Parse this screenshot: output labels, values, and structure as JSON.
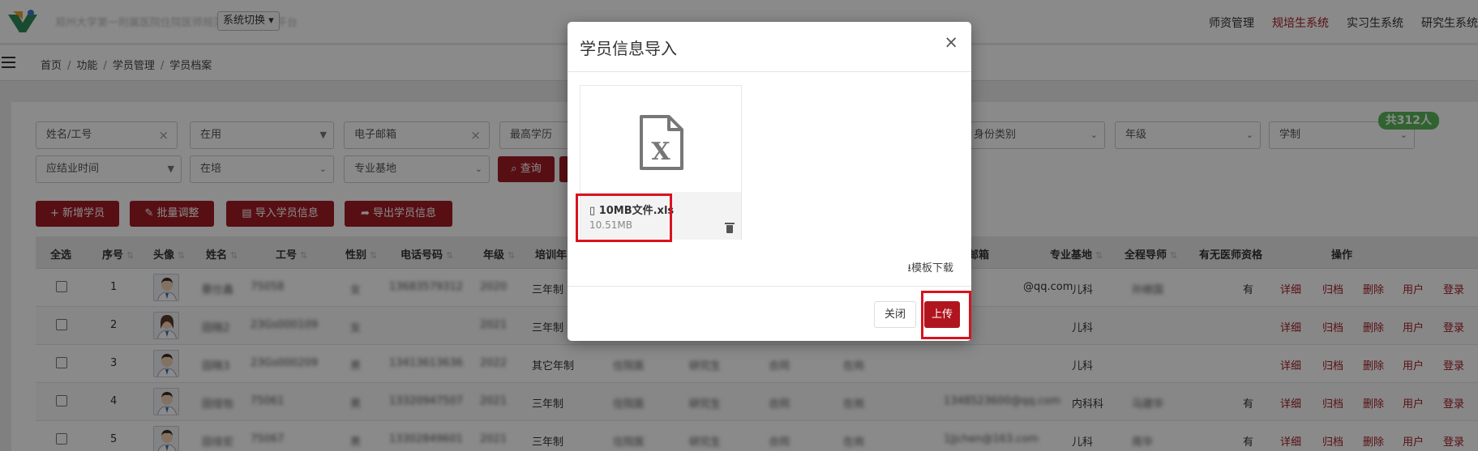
{
  "header": {
    "site_title": "郑州大学第一附属医院住院医师规范化培训管理平台",
    "system_switch": "系统切换",
    "nav": [
      "师资管理",
      "规培生系统",
      "实习生系统",
      "研究生系统"
    ],
    "active_nav": "规培生系统"
  },
  "breadcrumb": [
    "首页",
    "功能",
    "学员管理",
    "学员档案"
  ],
  "filters": {
    "name_id_placeholder": "姓名/工号",
    "status": "在用",
    "email_placeholder": "电子邮箱",
    "degree_placeholder": "最高学历",
    "identity_placeholder": "身份类别",
    "grade_placeholder": "年级",
    "schooling_placeholder": "学制",
    "graduation_placeholder": "应结业时间",
    "training_status": "在培",
    "base_placeholder": "专业基地",
    "query_label": "查询"
  },
  "toolbar": {
    "add_label": "新增学员",
    "batch_label": "批量调整",
    "import_label": "导入学员信息",
    "export_label": "导出学员信息"
  },
  "count_badge": "共312人",
  "table": {
    "headers": {
      "select_all": "全选",
      "index": "序号",
      "avatar": "头像",
      "name": "姓名",
      "job_id": "工号",
      "gender": "性别",
      "phone": "电话号码",
      "grade": "年级",
      "training_years": "培训年",
      "email": "邮箱",
      "base": "专业基地",
      "mentor": "全程导师",
      "doctor_qual": "有无医师资格",
      "actions": "操作"
    },
    "actions": [
      "详细",
      "归档",
      "删除",
      "用户",
      "登录"
    ],
    "rows": [
      {
        "index": "1",
        "name": "蔡仕鑫",
        "job_id": "75058",
        "gender": "女",
        "phone": "13683579312",
        "grade": "2020",
        "years": "三年制",
        "c1": "",
        "c2": "",
        "c3": "",
        "c4": "",
        "email": "@qq.com",
        "base": "儿科",
        "mentor": "孙继国",
        "qual": "有"
      },
      {
        "index": "2",
        "name": "田晓2",
        "job_id": "23Gs000109",
        "gender": "女",
        "phone": "",
        "grade": "2021",
        "years": "三年制",
        "c1": "",
        "c2": "",
        "c3": "",
        "c4": "",
        "email": "",
        "base": "儿科",
        "mentor": "",
        "qual": ""
      },
      {
        "index": "3",
        "name": "田晓3",
        "job_id": "23Gs000209",
        "gender": "男",
        "phone": "13413613636",
        "grade": "2022",
        "years": "其它年制",
        "c1": "住院医",
        "c2": "研究生",
        "c3": "合同",
        "c4": "在岗",
        "email": "",
        "base": "儿科",
        "mentor": "",
        "qual": ""
      },
      {
        "index": "4",
        "name": "田佳怡",
        "job_id": "75061",
        "gender": "男",
        "phone": "13320947507",
        "grade": "2021",
        "years": "三年制",
        "c1": "住院医",
        "c2": "研究生",
        "c3": "合同",
        "c4": "在岗",
        "email": "1348523600@qq.com",
        "base": "内科科",
        "mentor": "马建华",
        "qual": "有"
      },
      {
        "index": "5",
        "name": "田佳宏",
        "job_id": "75067",
        "gender": "男",
        "phone": "13302849601",
        "grade": "2021",
        "years": "三年制",
        "c1": "住院医",
        "c2": "研究生",
        "c3": "合同",
        "c4": "在岗",
        "email": "1Jjchen@163.com",
        "base": "儿科",
        "mentor": "周华",
        "qual": "有"
      }
    ]
  },
  "modal": {
    "title": "学员信息导入",
    "close_symbol": "×",
    "file_name": "10MB文件.xls",
    "file_size": "10.51MB",
    "template_download": "模板下载",
    "close_label": "关闭",
    "upload_label": "上传"
  },
  "colors": {
    "brand": "#a31d26",
    "badge": "#5cb85c",
    "highlight": "#d8121f"
  }
}
